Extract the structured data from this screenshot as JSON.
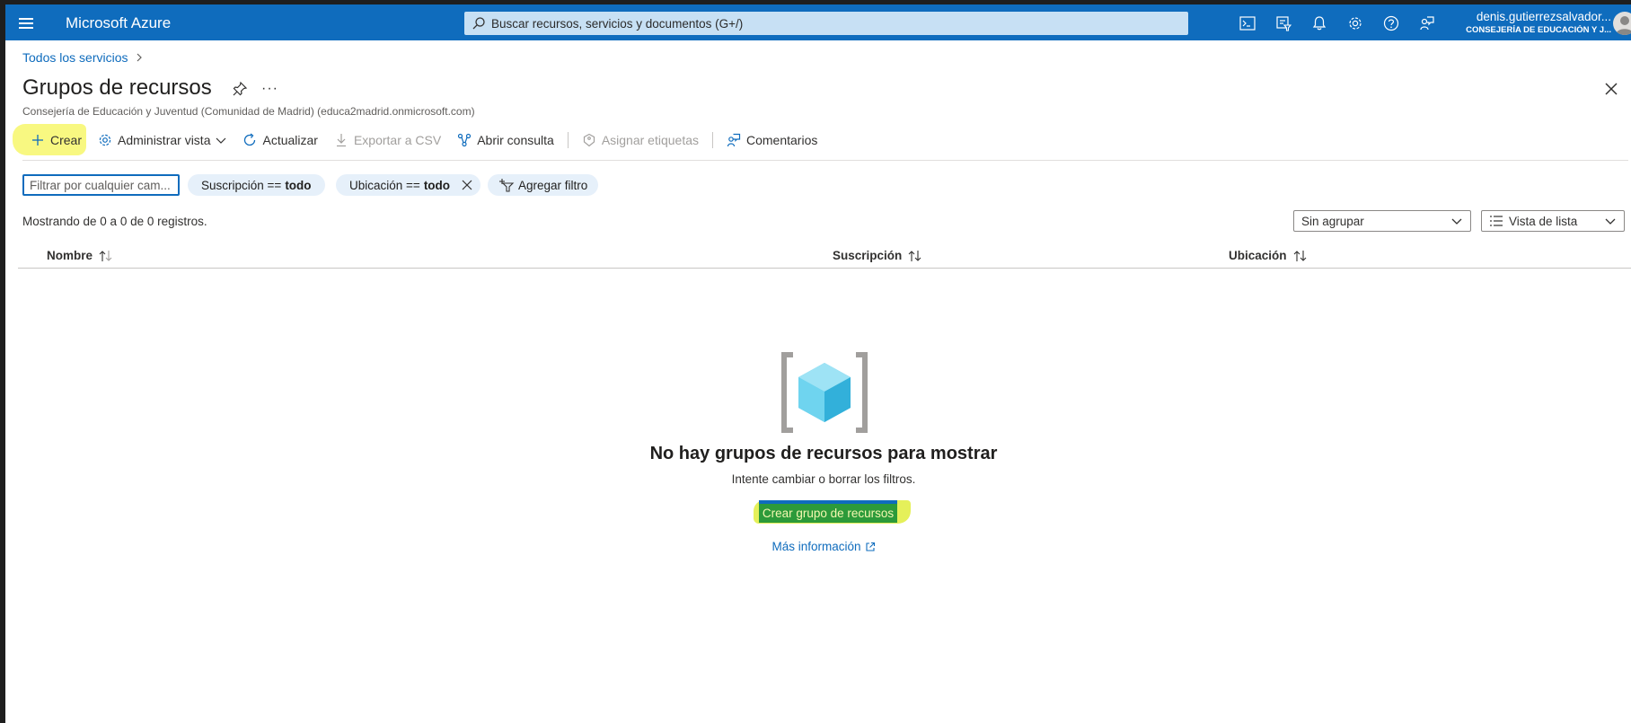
{
  "topbar": {
    "brand": "Microsoft Azure",
    "search_placeholder": "Buscar recursos, servicios y documentos (G+/)",
    "user_name": "denis.gutierrezsalvador...",
    "user_org": "CONSEJERÍA DE EDUCACIÓN Y J..."
  },
  "breadcrumb": {
    "item": "Todos los servicios"
  },
  "page": {
    "title": "Grupos de recursos",
    "subtitle": "Consejería de Educación y Juventud (Comunidad de Madrid) (educa2madrid.onmicrosoft.com)"
  },
  "toolbar": {
    "create": "Crear",
    "manage_view": "Administrar vista",
    "refresh": "Actualizar",
    "export_csv": "Exportar a CSV",
    "open_query": "Abrir consulta",
    "assign_tags": "Asignar etiquetas",
    "feedback": "Comentarios"
  },
  "filters": {
    "search_placeholder": "Filtrar por cualquier cam...",
    "subscription_label": "Suscripción ==",
    "subscription_value": "todo",
    "location_label": "Ubicación ==",
    "location_value": "todo",
    "add_filter": "Agregar filtro"
  },
  "records": {
    "summary": "Mostrando de 0 a 0 de 0 registros."
  },
  "view": {
    "grouping": "Sin agrupar",
    "list_view": "Vista de lista"
  },
  "table": {
    "columns": [
      "Nombre",
      "Suscripción",
      "Ubicación"
    ]
  },
  "empty_state": {
    "title": "No hay grupos de recursos para mostrar",
    "subtitle": "Intente cambiar o borrar los filtros.",
    "create_button": "Crear grupo de recursos",
    "more_info": "Más información"
  },
  "colors": {
    "azure_blue": "#0f6cbd",
    "highlight_yellow": "#f7f76b"
  }
}
